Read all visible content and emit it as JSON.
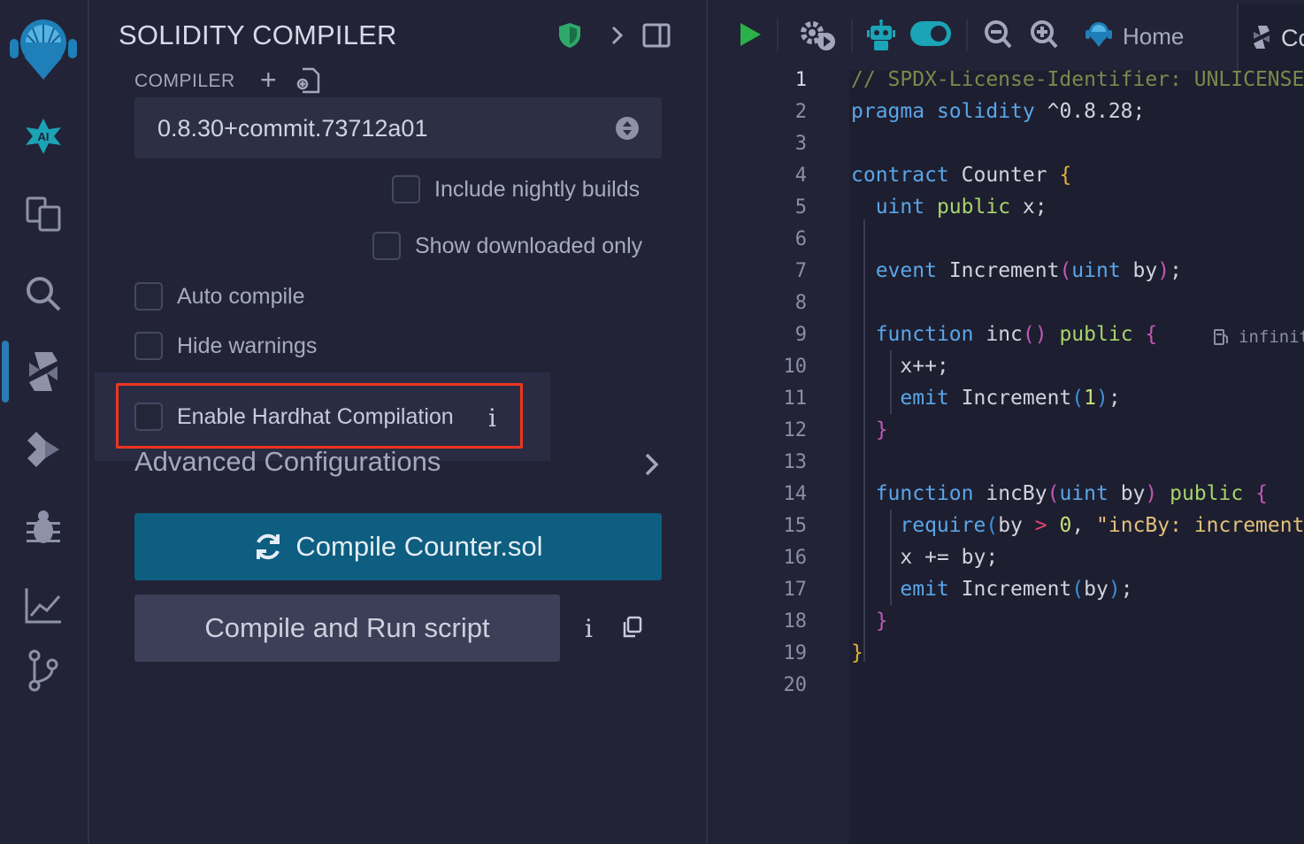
{
  "panel": {
    "title": "SOLIDITY COMPILER",
    "compiler_label": "COMPILER",
    "add_compiler": "+",
    "version": "0.8.30+commit.73712a01",
    "options": {
      "nightly": "Include nightly builds",
      "downloaded": "Show downloaded only",
      "auto_compile": "Auto compile",
      "hide_warnings": "Hide warnings",
      "hardhat": "Enable Hardhat Compilation",
      "hardhat_info": "i"
    },
    "advanced": "Advanced Configurations",
    "compile_button": "Compile Counter.sol",
    "run_button": "Compile and Run script",
    "run_info": "i"
  },
  "editor": {
    "home_tab": "Home",
    "file_tab": "Co",
    "gas_hint": "infinit",
    "line_numbers": [
      "1",
      "2",
      "3",
      "4",
      "5",
      "6",
      "7",
      "8",
      "9",
      "10",
      "11",
      "12",
      "13",
      "14",
      "15",
      "16",
      "17",
      "18",
      "19",
      "20"
    ],
    "tokens": {
      "l1": "// SPDX-License-Identifier: UNLICENSED",
      "l2a": "pragma",
      "l2b": "solidity",
      "l2c": "^0.8.28;",
      "l4a": "contract",
      "l4b": "Counter",
      "l4c": "{",
      "l5a": "uint",
      "l5b": "public",
      "l5c": "x;",
      "l7a": "event",
      "l7b": "Increment",
      "l7c": "(",
      "l7d": "uint",
      "l7e": "by",
      "l7f": ")",
      "l7g": ";",
      "l9a": "function",
      "l9b": "inc",
      "l9c": "()",
      "l9d": "public",
      "l9e": "{",
      "l10": "x++;",
      "l11a": "emit",
      "l11b": "Increment",
      "l11c": "(",
      "l11d": "1",
      "l11e": ")",
      "l11f": ";",
      "l12": "}",
      "l14a": "function",
      "l14b": "incBy",
      "l14c": "(",
      "l14d": "uint",
      "l14e": "by",
      "l14f": ")",
      "l14g": "public",
      "l14h": "{",
      "l15a": "require",
      "l15b": "(",
      "l15c": "by",
      "l15d": ">",
      "l15e": "0",
      "l15f": ",",
      "l15g": "\"incBy: increment should be positive\"",
      "l16a": "x",
      "l16b": "+=",
      "l16c": "by;",
      "l17a": "emit",
      "l17b": "Increment",
      "l17c": "(",
      "l17d": "by",
      "l17e": ")",
      "l17f": ";",
      "l18": "}",
      "l19": "}"
    }
  },
  "colors": {
    "accent": "#0d5e80",
    "highlight": "#f0341f",
    "shield": "#2ea86b",
    "run": "#2bb04a",
    "toggle": "#1ba3b6"
  }
}
